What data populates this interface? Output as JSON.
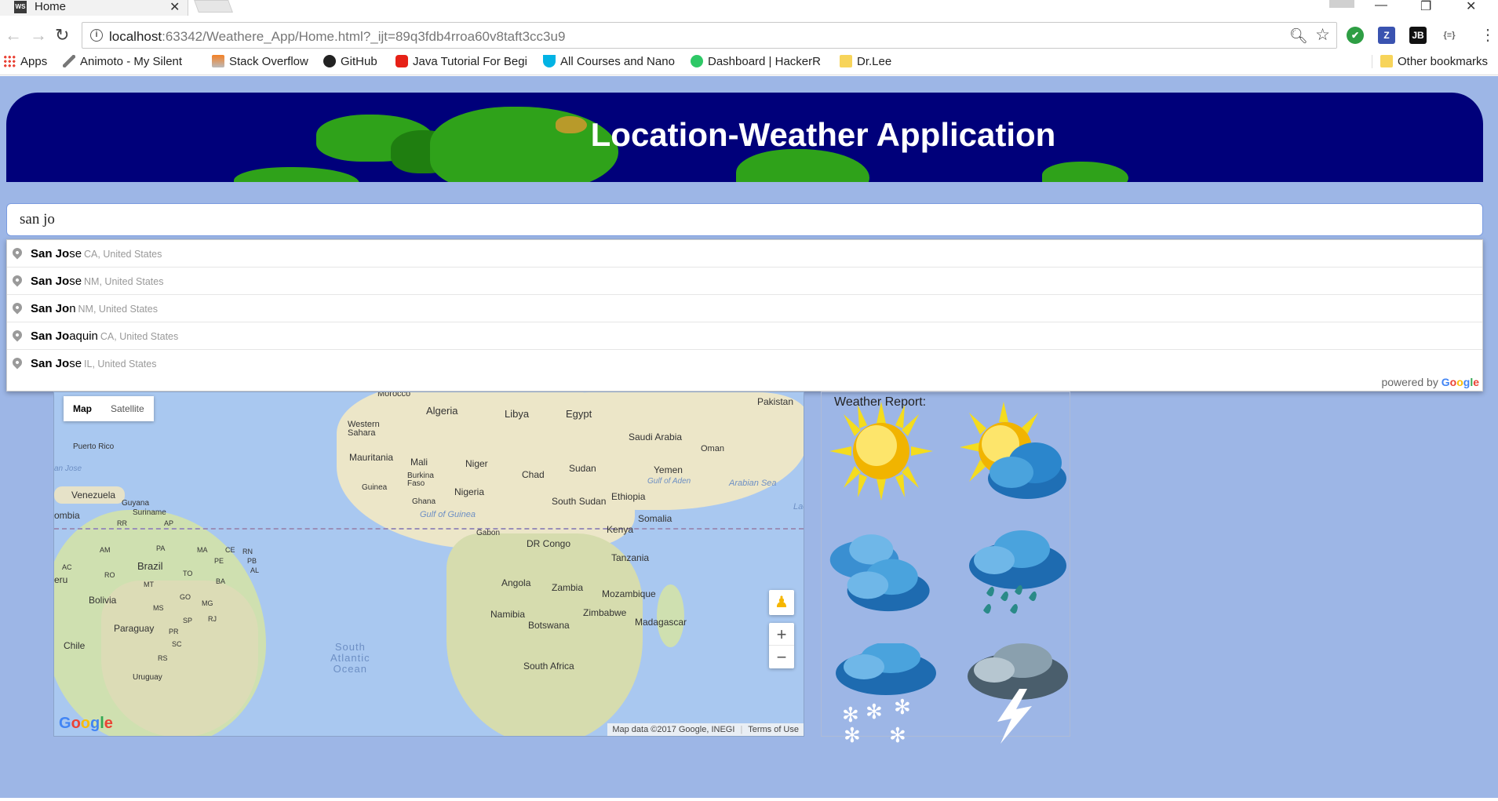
{
  "browser": {
    "tab_title": "Home",
    "tab_favicon": "WS",
    "url_host": "localhost",
    "url_rest": ":63342/Weathere_App/Home.html?_ijt=89q3fdb4rroa60v8taft3cc3u9",
    "bookmarks": [
      {
        "label": "Apps",
        "icon": "apps-grid-icon"
      },
      {
        "label": "Animoto - My Silent",
        "icon": "animoto-icon"
      },
      {
        "label": "Stack Overflow",
        "icon": "stackoverflow-icon"
      },
      {
        "label": "GitHub",
        "icon": "github-icon"
      },
      {
        "label": "Java Tutorial For Begi",
        "icon": "youtube-icon"
      },
      {
        "label": "All Courses and Nano",
        "icon": "udacity-icon"
      },
      {
        "label": "Dashboard | HackerR",
        "icon": "hackerrank-icon"
      },
      {
        "label": "Dr.Lee",
        "icon": "folder-icon"
      }
    ],
    "other_bookmarks": "Other bookmarks"
  },
  "header": {
    "title": "Location-Weather Application"
  },
  "search": {
    "value": "san jo"
  },
  "suggestions": [
    {
      "match": "San Jo",
      "rest": "se",
      "secondary": "CA, United States"
    },
    {
      "match": "San Jo",
      "rest": "se",
      "secondary": "NM, United States"
    },
    {
      "match": "San Jo",
      "rest": "n",
      "secondary": "NM, United States"
    },
    {
      "match": "San Jo",
      "rest": "aquin",
      "secondary": "CA, United States"
    },
    {
      "match": "San Jo",
      "rest": "se",
      "secondary": "IL, United States"
    }
  ],
  "powered_by": "powered by",
  "map": {
    "type_map": "Map",
    "type_satellite": "Satellite",
    "labels": {
      "pakistan": "Pakistan",
      "algeria": "Algeria",
      "libya": "Libya",
      "egypt": "Egypt",
      "western_sahara": "Western\nSahara",
      "saudi": "Saudi Arabia",
      "oman": "Oman",
      "mauritania": "Mauritania",
      "mali": "Mali",
      "niger": "Niger",
      "chad": "Chad",
      "sudan": "Sudan",
      "yemen": "Yemen",
      "puerto_rico": "Puerto Rico",
      "san_jose": "an Jose",
      "gulf_aden": "Gulf of Aden",
      "arabian_sea": "Arabian Sea",
      "burkina": "Burkina\nFaso",
      "guinea": "Guinea",
      "nigeria": "Nigeria",
      "ethiopia": "Ethiopia",
      "venezuela": "Venezuela",
      "guyana": "Guyana",
      "suriname": "Suriname",
      "south_sudan": "South Sudan",
      "ghana": "Ghana",
      "colombia": "ombia",
      "gulf_guinea": "Gulf of Guinea",
      "somalia": "Somalia",
      "lac": "Lac",
      "rr": "RR",
      "ap": "AP",
      "kenya": "Kenya",
      "gabon": "Gabon",
      "dr_congo": "DR Congo",
      "am": "AM",
      "pa": "PA",
      "ma": "MA",
      "ce": "CE",
      "rn": "RN",
      "pb": "PB",
      "pe": "PE",
      "al": "AL",
      "tanzania": "Tanzania",
      "peru": "eru",
      "brazil": "Brazil",
      "to": "TO",
      "ba": "BA",
      "ac": "AC",
      "ro": "RO",
      "mt": "MT",
      "angola": "Angola",
      "zambia": "Zambia",
      "mozambique": "Mozambique",
      "bolivia": "Bolivia",
      "go": "GO",
      "mg": "MG",
      "ms": "MS",
      "sp": "SP",
      "rj": "RJ",
      "namibia": "Namibia",
      "zimbabwe": "Zimbabwe",
      "madagascar": "Madagascar",
      "botswana": "Botswana",
      "paraguay": "Paraguay",
      "pr": "PR",
      "sc": "SC",
      "rs": "RS",
      "chile": "Chile",
      "ocean": "South\nAtlantic\nOcean",
      "south_africa": "South Africa",
      "uruguay": "Uruguay",
      "morocco": "Morocco"
    },
    "zoom_in": "+",
    "zoom_out": "−",
    "attribution": "Map data ©2017 Google, INEGI",
    "terms": "Terms of Use"
  },
  "weather": {
    "title": "Weather Report:",
    "icons": [
      "sunny-icon",
      "partly-cloudy-icon",
      "cloudy-icon",
      "rain-icon",
      "snow-icon",
      "thunderstorm-icon"
    ]
  },
  "colors": {
    "page_background": "#9db6e6",
    "banner": "#00007a",
    "land": "#2fa21a"
  }
}
